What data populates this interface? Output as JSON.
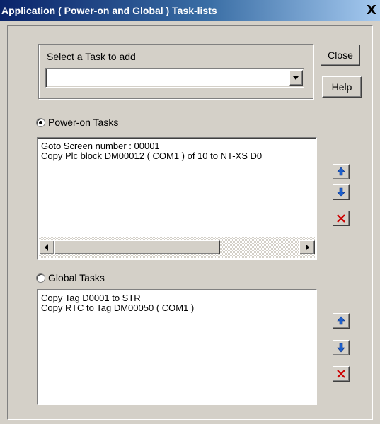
{
  "window": {
    "title": "Application ( Power-on and Global ) Task-lists",
    "close_glyph": "X"
  },
  "task_select": {
    "label": "Select a Task to add",
    "value": ""
  },
  "buttons": {
    "close": "Close",
    "help": "Help"
  },
  "power_on": {
    "label": "Power-on Tasks",
    "selected": true,
    "items": [
      "Goto Screen number : 00001",
      "Copy Plc block DM00012 ( COM1 ) of 10 to NT-XS D0"
    ]
  },
  "global": {
    "label": "Global Tasks",
    "selected": false,
    "items": [
      "Copy Tag D0001 to STR",
      "Copy RTC to Tag DM00050 ( COM1 )"
    ]
  },
  "colors": {
    "move_arrow": "#1c5fcc",
    "delete": "#cc0000",
    "title_bar": "#0a246a"
  }
}
